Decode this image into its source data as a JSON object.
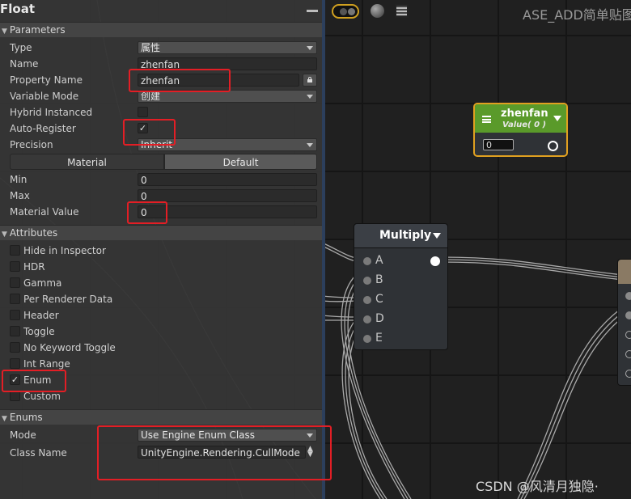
{
  "panel": {
    "title": "Float",
    "sections": {
      "parameters": "Parameters",
      "attributes": "Attributes",
      "enums": "Enums"
    },
    "params": {
      "type_label": "Type",
      "type_value": "属性",
      "name_label": "Name",
      "name_value": "zhenfan",
      "property_name_label": "Property Name",
      "property_name_value": "zhenfan",
      "variable_mode_label": "Variable Mode",
      "variable_mode_value": "创建",
      "hybrid_instanced_label": "Hybrid Instanced",
      "auto_register_label": "Auto-Register",
      "auto_register_checked": true,
      "precision_label": "Precision",
      "precision_value": "Inherit",
      "material_tab": "Material",
      "default_tab": "Default",
      "min_label": "Min",
      "min_value": "0",
      "max_label": "Max",
      "max_value": "0",
      "material_value_label": "Material Value",
      "material_value": "0"
    },
    "attributes": [
      {
        "label": "Hide in Inspector",
        "checked": false
      },
      {
        "label": "HDR",
        "checked": false
      },
      {
        "label": "Gamma",
        "checked": false
      },
      {
        "label": "Per Renderer Data",
        "checked": false
      },
      {
        "label": "Header",
        "checked": false
      },
      {
        "label": "Toggle",
        "checked": false
      },
      {
        "label": "No Keyword Toggle",
        "checked": false
      },
      {
        "label": "Int Range",
        "checked": false
      },
      {
        "label": "Enum",
        "checked": true
      },
      {
        "label": "Custom",
        "checked": false
      }
    ],
    "enums": {
      "mode_label": "Mode",
      "mode_value": "Use Engine Enum Class",
      "class_name_label": "Class Name",
      "class_name_value": "UnityEngine.Rendering.CullMode"
    }
  },
  "canvas": {
    "window_title": "ASE_ADD简单贴图",
    "float_node": {
      "title": "zhenfan",
      "subtitle": "Value( 0 )",
      "value": "0",
      "color": "#5a9a2a",
      "border_color": "#e0a020"
    },
    "multiply_node": {
      "title": "Multiply",
      "ports": [
        "A",
        "B",
        "C",
        "D",
        "E"
      ]
    },
    "watermark": "CSDN @风清月独隐·"
  },
  "colors": {
    "highlight": "#e31e25",
    "panel_bg": "#383838"
  }
}
